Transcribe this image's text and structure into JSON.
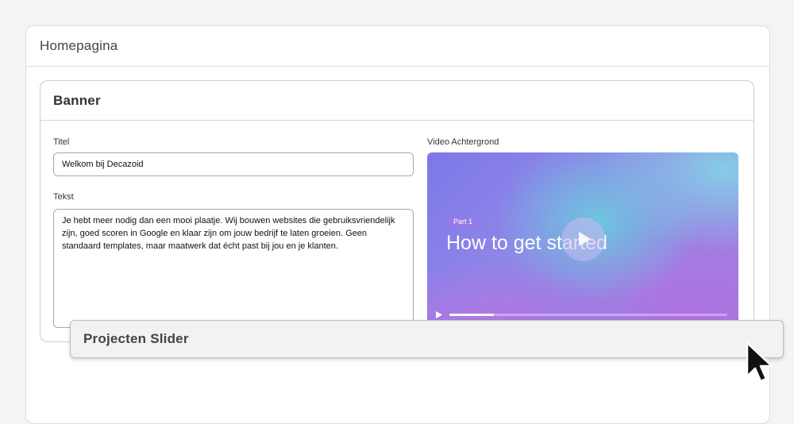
{
  "homepage": {
    "title": "Homepagina"
  },
  "banner": {
    "title": "Banner",
    "titel_label": "Titel",
    "titel_value": "Welkom bij Decazoid",
    "tekst_label": "Tekst",
    "tekst_value": "Je hebt meer nodig dan een mooi plaatje. Wij bouwen websites die gebruiksvriendelijk zijn, goed scoren in Google en klaar zijn om jouw bedrijf te laten groeien. Geen standaard templates, maar maatwerk dat écht past bij jou en je klanten.",
    "video_label": "Video Achtergrond"
  },
  "video": {
    "badge": "Part 1",
    "title": "How to get started",
    "progress": 0.16
  },
  "projecten": {
    "title": "Projecten Slider"
  },
  "icons": {
    "play": "play-icon",
    "cursor": "cursor-arrow-icon"
  }
}
